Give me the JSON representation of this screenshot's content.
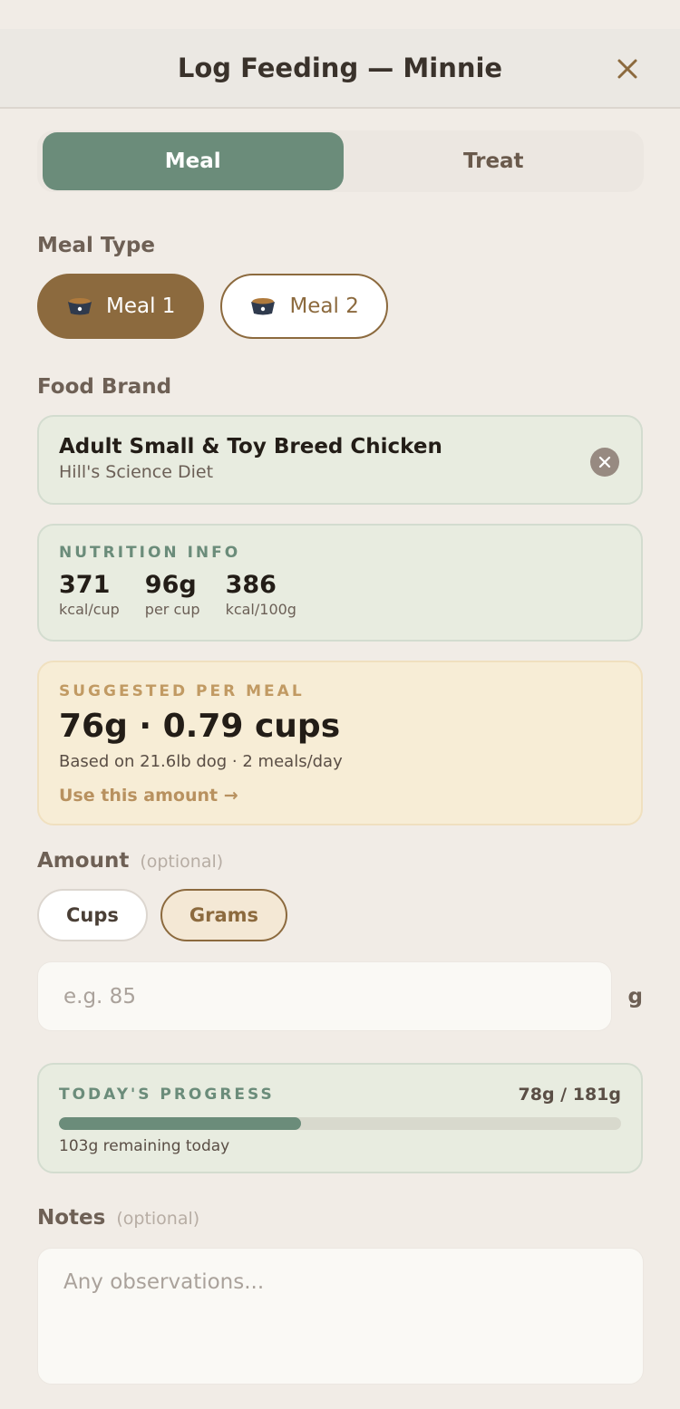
{
  "header": {
    "title": "Log Feeding — Minnie",
    "close_icon": "close-icon"
  },
  "tabs": [
    {
      "label": "Meal",
      "active": true
    },
    {
      "label": "Treat",
      "active": false
    }
  ],
  "meal_type": {
    "label": "Meal Type",
    "options": [
      {
        "label": "Meal 1",
        "icon": "dog-bowl-icon",
        "selected": true
      },
      {
        "label": "Meal 2",
        "icon": "dog-bowl-icon",
        "selected": false
      }
    ]
  },
  "food_brand": {
    "label": "Food Brand",
    "product": "Adult Small & Toy Breed Chicken",
    "brand": "Hill's Science Diet"
  },
  "nutrition": {
    "title": "NUTRITION INFO",
    "items": [
      {
        "value": "371",
        "unit": "kcal/cup"
      },
      {
        "value": "96g",
        "unit": "per cup"
      },
      {
        "value": "386",
        "unit": "kcal/100g"
      }
    ]
  },
  "suggested": {
    "title": "SUGGESTED PER MEAL",
    "amount": "76g · 0.79 cups",
    "basis": "Based on 21.6lb dog · 2 meals/day",
    "action": "Use this amount →"
  },
  "amount": {
    "label": "Amount",
    "optional": "(optional)",
    "units": [
      {
        "label": "Cups",
        "selected": false
      },
      {
        "label": "Grams",
        "selected": true
      }
    ],
    "placeholder": "e.g. 85",
    "unit_suffix": "g"
  },
  "progress": {
    "title": "TODAY'S PROGRESS",
    "count": "78g / 181g",
    "fraction": 0.431,
    "remaining": "103g remaining today"
  },
  "notes": {
    "label": "Notes",
    "optional": "(optional)",
    "placeholder": "Any observations..."
  },
  "colors": {
    "accent_green": "#6b8c7a",
    "accent_brown": "#8c6a3e",
    "background": "#f1ece6"
  }
}
